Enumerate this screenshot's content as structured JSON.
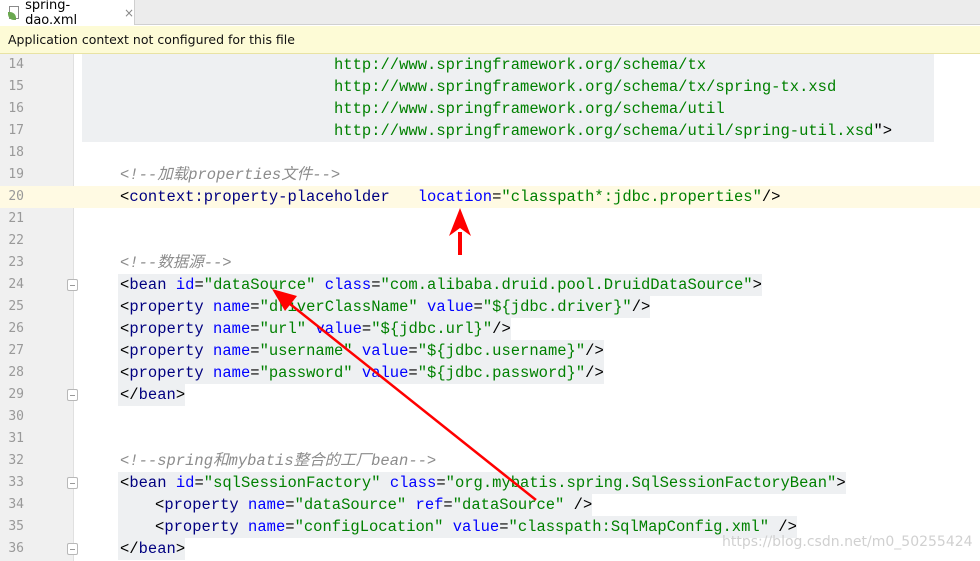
{
  "tab": {
    "title": "spring-dao.xml",
    "close": "×"
  },
  "banner": {
    "text": "Application context not configured for this file"
  },
  "lines": {
    "n14": "14",
    "n15": "15",
    "n16": "16",
    "n17": "17",
    "n18": "18",
    "n19": "19",
    "n20": "20",
    "n21": "21",
    "n22": "22",
    "n23": "23",
    "n24": "24",
    "n25": "25",
    "n26": "26",
    "n27": "27",
    "n28": "28",
    "n29": "29",
    "n30": "30",
    "n31": "31",
    "n32": "32",
    "n33": "33",
    "n34": "34",
    "n35": "35",
    "n36": "36"
  },
  "code": {
    "l14": "http://www.springframework.org/schema/tx",
    "l15": "http://www.springframework.org/schema/tx/spring-tx.xsd",
    "l16": "http://www.springframework.org/schema/util",
    "l17a": "http://www.springframework.org/schema/util/spring-util.xsd",
    "l17b": "\">",
    "l19": "<!--加载properties文件-->",
    "l20": {
      "lt": "<",
      "tag": "context:property-placeholder",
      "sp": "  ",
      "attr": "location",
      "eq": "=",
      "val": "\"classpath*:jdbc.properties\"",
      "end": "/>"
    },
    "l23": "<!--数据源-->",
    "l24": {
      "lt": "<",
      "tag": "bean",
      "a1": "id",
      "v1": "\"dataSource\"",
      "a2": "class",
      "v2": "\"com.alibaba.druid.pool.DruidDataSource\"",
      "end": ">"
    },
    "l25": {
      "lt": "<",
      "tag": "property",
      "a1": "name",
      "v1": "\"driverClassName\"",
      "a2": "value",
      "v2": "\"${jdbc.driver}\"",
      "end": "/>"
    },
    "l26": {
      "lt": "<",
      "tag": "property",
      "a1": "name",
      "v1": "\"url\"",
      "a2": "value",
      "v2": "\"${jdbc.url}\"",
      "end": "/>"
    },
    "l27": {
      "lt": "<",
      "tag": "property",
      "a1": "name",
      "v1": "\"username\"",
      "a2": "value",
      "v2": "\"${jdbc.username}\"",
      "end": "/>"
    },
    "l28": {
      "lt": "<",
      "tag": "property",
      "a1": "name",
      "v1": "\"password\"",
      "a2": "value",
      "v2": "\"${jdbc.password}\"",
      "end": "/>"
    },
    "l29": {
      "lt": "</",
      "tag": "bean",
      "end": ">"
    },
    "l32": "<!--spring和mybatis整合的工厂bean-->",
    "l33": {
      "lt": "<",
      "tag": "bean",
      "a1": "id",
      "v1": "\"sqlSessionFactory\"",
      "a2": "class",
      "v2": "\"org.mybatis.spring.SqlSessionFactoryBean\"",
      "end": ">"
    },
    "l34": {
      "lt": "<",
      "tag": "property",
      "a1": "name",
      "v1": "\"dataSource\"",
      "a2": "ref",
      "v2": "\"dataSource\"",
      "end": " />"
    },
    "l35": {
      "lt": "<",
      "tag": "property",
      "a1": "name",
      "v1": "\"configLocation\"",
      "a2": "value",
      "v2": "\"classpath:SqlMapConfig.xml\"",
      "end": " />"
    },
    "l36": {
      "lt": "</",
      "tag": "bean",
      "end": ">"
    }
  },
  "watermark": "https://blog.csdn.net/m0_50255424",
  "colors": {
    "tag": "#000080",
    "attribute": "#0000ff",
    "value": "#008000",
    "comment": "#8c8c8c",
    "arrow": "#ff0000",
    "banner": "#fdfbd6"
  }
}
